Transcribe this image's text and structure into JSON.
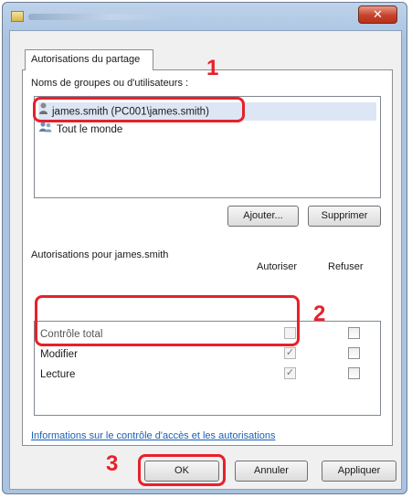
{
  "window": {
    "close_glyph": "✕",
    "tab_label": "Autorisations du partage"
  },
  "groups": {
    "label": "Noms de groupes ou d'utilisateurs :",
    "items": [
      {
        "name": "james.smith (PC001\\james.smith)",
        "icon": "user-icon"
      },
      {
        "name": "Tout le monde",
        "icon": "group-icon"
      }
    ]
  },
  "buttons": {
    "add": "Ajouter...",
    "remove": "Supprimer",
    "ok": "OK",
    "cancel": "Annuler",
    "apply": "Appliquer"
  },
  "permissions": {
    "title": "Autorisations pour james.smith",
    "allow_header": "Autoriser",
    "deny_header": "Refuser",
    "rows": [
      {
        "name": "Contrôle total",
        "allow": false,
        "deny": false
      },
      {
        "name": "Modifier",
        "allow": true,
        "deny": false
      },
      {
        "name": "Lecture",
        "allow": true,
        "deny": false
      }
    ]
  },
  "link_text": "Informations sur le contrôle d'accès et les autorisations",
  "annotations": {
    "accent_color": "#e8202a",
    "step1": "1",
    "step2": "2",
    "step3": "3"
  }
}
